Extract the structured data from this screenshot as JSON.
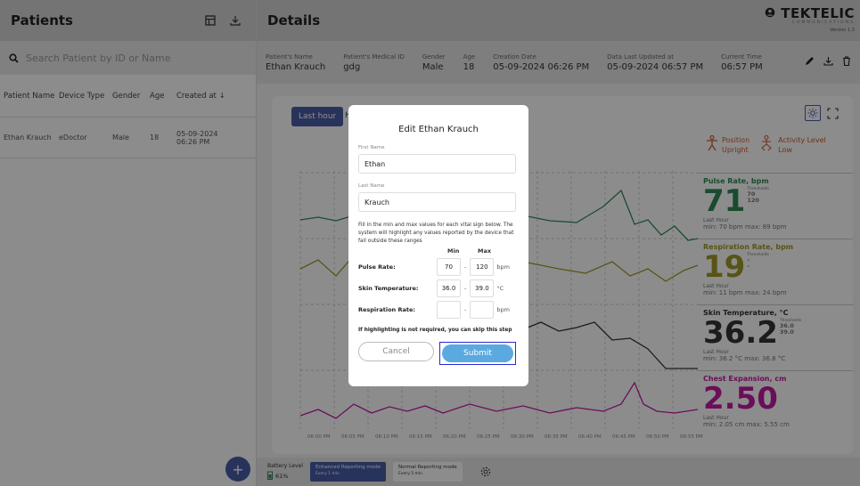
{
  "patients": {
    "title": "Patients",
    "search_placeholder": "Search Patient by ID or Name",
    "columns": [
      "Patient Name",
      "Device Type",
      "Gender",
      "Age",
      "Created at ↓"
    ],
    "rows": [
      {
        "name": "Ethan Krauch",
        "device": "eDoctor",
        "gender": "Male",
        "age": "18",
        "created": "05-09-2024 06:26 PM"
      }
    ],
    "add_label": "+"
  },
  "details": {
    "title": "Details",
    "brand": {
      "name": "TEKTELIC",
      "sub": "COMMUNICATIONS",
      "version": "Version 1.3"
    },
    "fields": [
      {
        "label": "Patient's Name",
        "value": "Ethan Krauch"
      },
      {
        "label": "Patient's Medical ID",
        "value": "gdg"
      },
      {
        "label": "Gender",
        "value": "Male"
      },
      {
        "label": "Age",
        "value": "18"
      },
      {
        "label": "Creation Date",
        "value": "05-09-2024 06:26 PM"
      },
      {
        "label": "Data Last Updated at",
        "value": "05-09-2024 06:57 PM"
      },
      {
        "label": "Current Time",
        "value": "06:57 PM"
      }
    ]
  },
  "chart_panel": {
    "last_hour": "Last hour",
    "h_tab": "H",
    "position_label": "Position",
    "position_value": "Upright",
    "activity_label": "Activity Level",
    "activity_value": "Low",
    "x_ticks": [
      "06:00 PM",
      "06:05 PM",
      "06:10 PM",
      "06:15 PM",
      "06:20 PM",
      "06:25 PM",
      "06:30 PM",
      "06:35 PM",
      "06:40 PM",
      "06:45 PM",
      "06:50 PM",
      "06:55 PM"
    ]
  },
  "vitals": [
    {
      "name": "Pulse Rate, bpm",
      "value": "71",
      "thr_label": "Thresholds",
      "thr1": "70",
      "thr2": "120",
      "last": "Last Hour",
      "minmax": "min: 70 bpm  max: 89 bpm",
      "color": "#2e8b57"
    },
    {
      "name": "Respiration Rate, bpm",
      "value": "19",
      "thr_label": "Thresholds",
      "thr1": "-",
      "thr2": "-",
      "last": "Last Hour",
      "minmax": "min: 11 bpm  max: 24 bpm",
      "color": "#a09a2a"
    },
    {
      "name": "Skin Temperature, °C",
      "value": "36.2",
      "thr_label": "Thresholds",
      "thr1": "36.0",
      "thr2": "39.0",
      "last": "Last Hour",
      "minmax": "min: 36.2 °C  max: 36.8 °C",
      "color": "#333333"
    },
    {
      "name": "Chest Expansion, cm",
      "value": "2.50",
      "thr_label": "",
      "thr1": "",
      "thr2": "",
      "last": "Last Hour",
      "minmax": "min: 2.05 cm  max: 5.55 cm",
      "color": "#c21aa3"
    }
  ],
  "bottom": {
    "battery_label": "Battery Level",
    "battery_value": "61%",
    "mode1": "Enhanced Reporting mode",
    "mode1_sub": "Every 1 min",
    "mode2": "Normal Reporting mode",
    "mode2_sub": "Every 5 min"
  },
  "modal": {
    "title": "Edit Ethan Krauch",
    "first_label": "First Name",
    "first_value": "Ethan",
    "last_label": "Last Name",
    "last_value": "Krauch",
    "note": "Fill in the min and max values for each vital sign below. The system will highlight any values reported by the device that fall outside these ranges",
    "min_label": "Min",
    "max_label": "Max",
    "ranges": [
      {
        "label": "Pulse Rate:",
        "min": "70",
        "max": "120",
        "unit": "bpm"
      },
      {
        "label": "Skin Temperature:",
        "min": "36.0",
        "max": "39.0",
        "unit": "°C"
      },
      {
        "label": "Respiration Rate:",
        "min": "",
        "max": "",
        "unit": "bpm"
      }
    ],
    "skip_note": "If highlighting is not required, you can skip this step",
    "cancel": "Cancel",
    "submit": "Submit"
  }
}
